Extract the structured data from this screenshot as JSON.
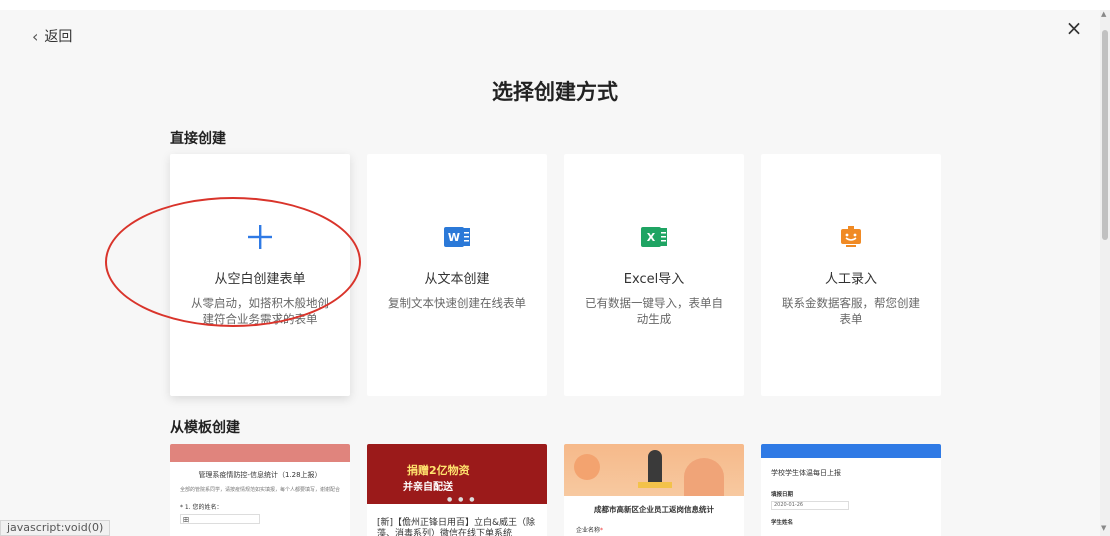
{
  "nav": {
    "back_label": "返回",
    "close_glyph": "×"
  },
  "page_title": "选择创建方式",
  "direct_section": {
    "title": "直接创建",
    "cards": [
      {
        "name": "从空白创建表单",
        "desc": "从零启动，如搭积木般地创建符合业务需求的表单",
        "icon": "plus-icon",
        "icon_glyph": "+"
      },
      {
        "name": "从文本创建",
        "desc": "复制文本快速创建在线表单",
        "icon": "word-icon",
        "icon_glyph": "W"
      },
      {
        "name": "Excel导入",
        "desc": "已有数据一键导入，表单自动生成",
        "icon": "excel-icon",
        "icon_glyph": "X"
      },
      {
        "name": "人工录入",
        "desc": "联系金数据客服，帮您创建表单",
        "icon": "service-robot-icon",
        "icon_glyph": "ü"
      }
    ]
  },
  "template_section": {
    "title": "从模板创建",
    "templates": [
      {
        "title": "管理系疫情防控-信息统计（1.28上报）",
        "paragraph": "全部的管院系同学，请按疫情规范如实填报，每个人都要填写，谢谢配合",
        "question": "* 1. 您的姓名：",
        "input": "田"
      },
      {
        "banner_line1": "捐赠2亿物资",
        "banner_line2": "并亲自配送",
        "caption": "[新]【儋州正锋日用百】立白&威王（除藻、消毒系列）微信在线下单系统"
      },
      {
        "title": "成都市高新区企业员工返岗信息统计",
        "question": "企业名称",
        "required_mark": "*"
      },
      {
        "title": "学校学生体温每日上报",
        "q1": "填报日期",
        "input1": "2020-01-26",
        "q2": "学生姓名"
      }
    ]
  },
  "status_bar": "javascript:void(0)",
  "colors": {
    "highlight": "#d9342b",
    "plus": "#2f7ae5",
    "word": "#2b79d8",
    "excel": "#1fa463",
    "robot": "#f08a24"
  }
}
